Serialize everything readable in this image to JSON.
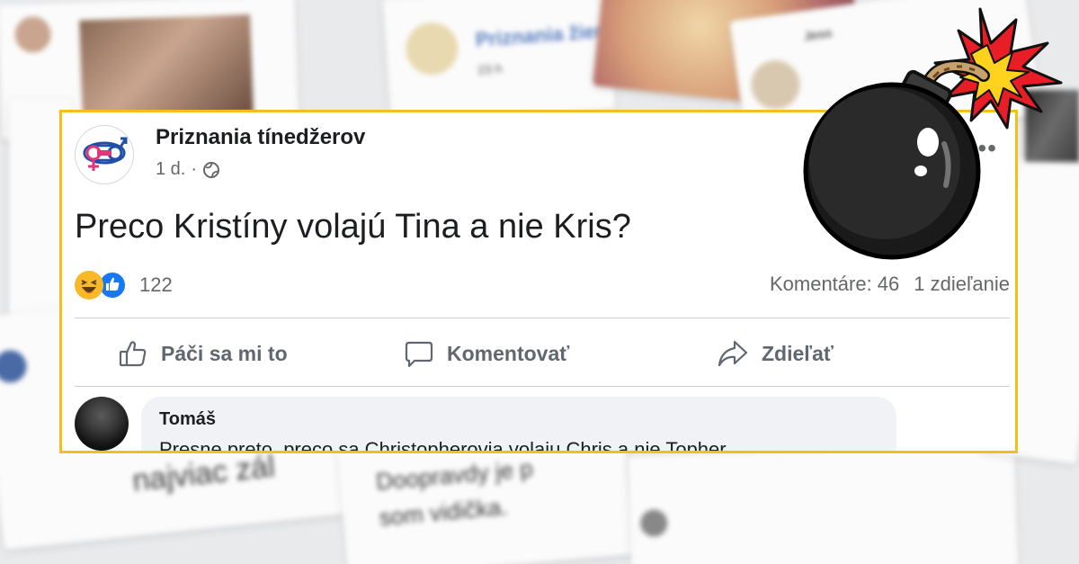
{
  "post": {
    "page_name": "Priznania tínedžerov",
    "time": "1 d.",
    "privacy_icon": "globe-icon",
    "more_icon": "more-options-icon",
    "more_label": "•••",
    "text": "Preco Kristíny volajú Tina a nie Kris?",
    "reaction_icons": [
      "haha-reaction-icon",
      "like-reaction-icon"
    ],
    "reaction_count": "122",
    "comments_label": "Komentáre: 46",
    "shares_label": "1 zdieľanie",
    "actions": {
      "like": "Páči sa mi to",
      "comment": "Komentovať",
      "share": "Zdieľať"
    },
    "comment": {
      "author": "Tomáš",
      "text": "Presne preto, preco sa Christopherovia volaju Chris a nie Topher"
    }
  },
  "background": {
    "card_page_name": "Priznania žien",
    "card_time": "23 h",
    "card_username": "Jess",
    "blurred_line_1": "najviac zál",
    "blurred_line_2": "Doopravdy je p",
    "blurred_line_3": "som vidička."
  },
  "decoration": {
    "bomb_icon": "bomb-icon"
  },
  "colors": {
    "highlight_border": "#f2bf1b",
    "like_blue": "#1877f2",
    "haha_yellow": "#f7b928",
    "text_primary": "#1c1e21",
    "text_secondary": "#65676b"
  }
}
